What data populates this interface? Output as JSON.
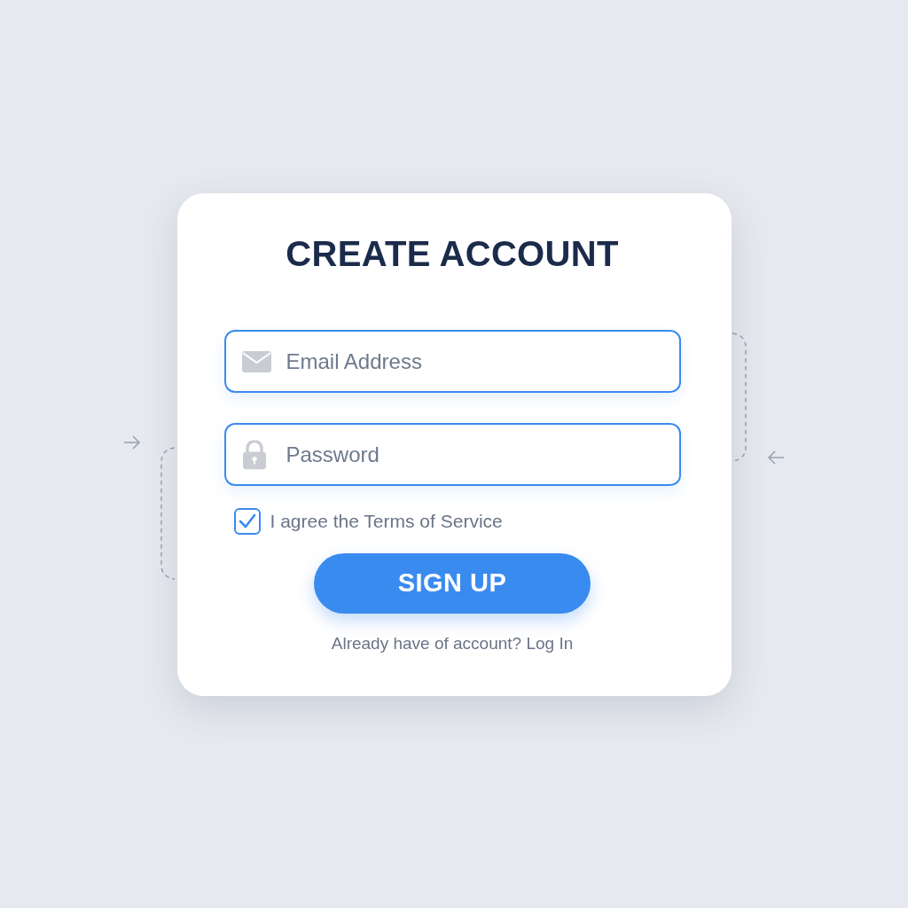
{
  "title": "CREATE ACCOUNT",
  "fields": [
    {
      "kind": "email",
      "placeholder": "Email Address"
    },
    {
      "kind": "password",
      "placeholder": "Password"
    }
  ],
  "agreement": {
    "label": "I agree the Terms of Service",
    "checked": true
  },
  "submit": {
    "label": "SIGN UP"
  },
  "footer": {
    "text": "Already have of account?",
    "link": "Log In"
  }
}
